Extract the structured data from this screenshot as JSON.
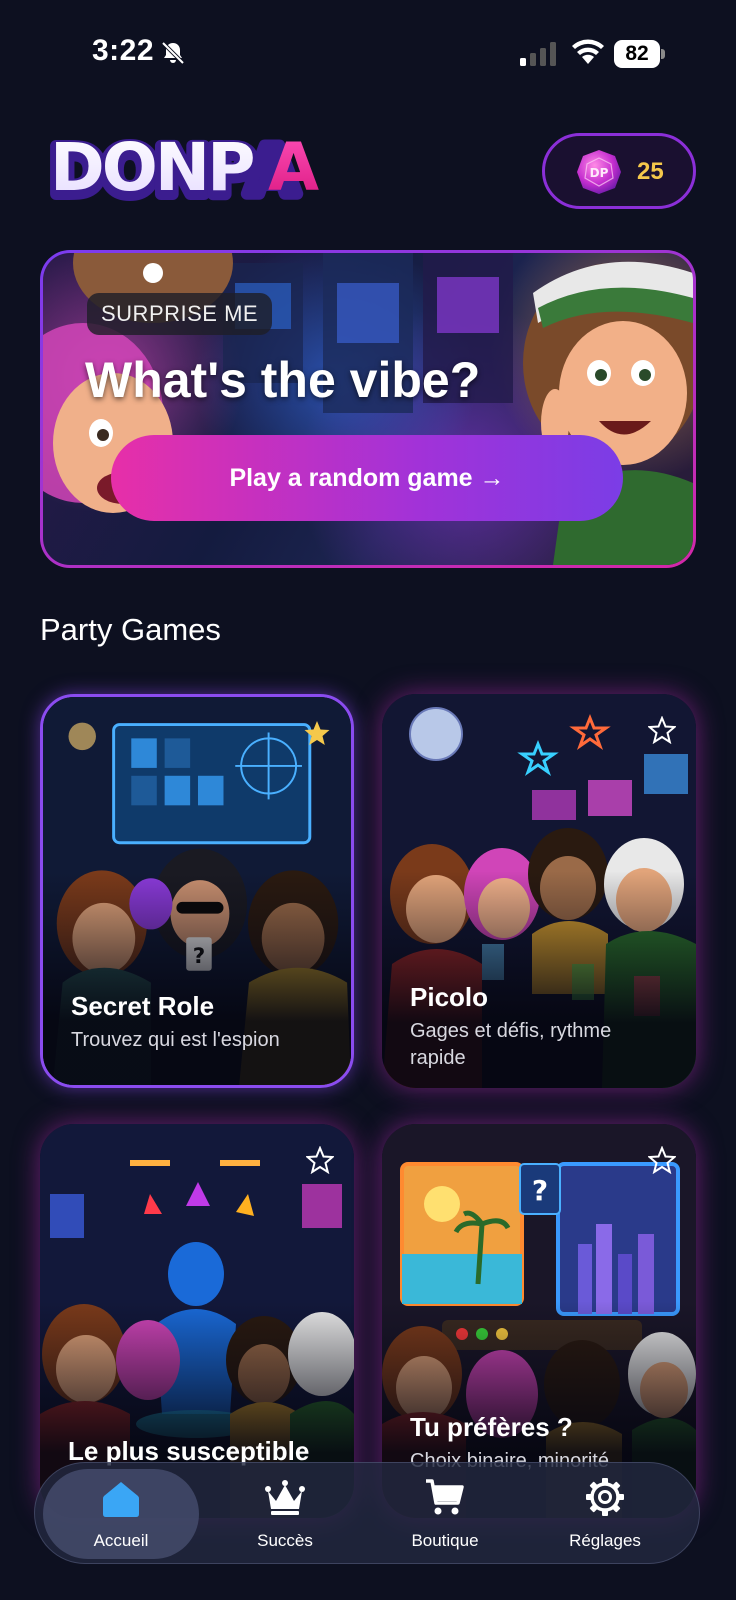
{
  "status_bar": {
    "time": "3:22",
    "battery": "82"
  },
  "header": {
    "logo_text": "DONPA",
    "coins": "25",
    "gem_label": "DP"
  },
  "hero": {
    "tag": "SURPRISE ME",
    "title": "What's the vibe?",
    "cta": "Play a random game →"
  },
  "section": {
    "title": "Party Games"
  },
  "games": [
    {
      "title": "Secret Role",
      "subtitle": "Trouvez qui est l'espion",
      "favorite": true
    },
    {
      "title": "Picolo",
      "subtitle": "Gages et défis, rythme rapide",
      "favorite": false
    },
    {
      "title": "Le plus susceptible",
      "subtitle": "",
      "favorite": false
    },
    {
      "title": "Tu préfères ?",
      "subtitle": "Choix binaire, minorité",
      "favorite": false
    }
  ],
  "nav": {
    "items": [
      {
        "label": "Accueil",
        "icon": "home-icon",
        "active": true
      },
      {
        "label": "Succès",
        "icon": "crown-icon",
        "active": false
      },
      {
        "label": "Boutique",
        "icon": "cart-icon",
        "active": false
      },
      {
        "label": "Réglages",
        "icon": "gear-icon",
        "active": false
      }
    ]
  },
  "colors": {
    "accent_purple": "#8b2fd8",
    "accent_pink": "#e72fa8",
    "coin_gold": "#f5c84b",
    "background": "#0d1020",
    "home_blue": "#3aa6f5"
  }
}
